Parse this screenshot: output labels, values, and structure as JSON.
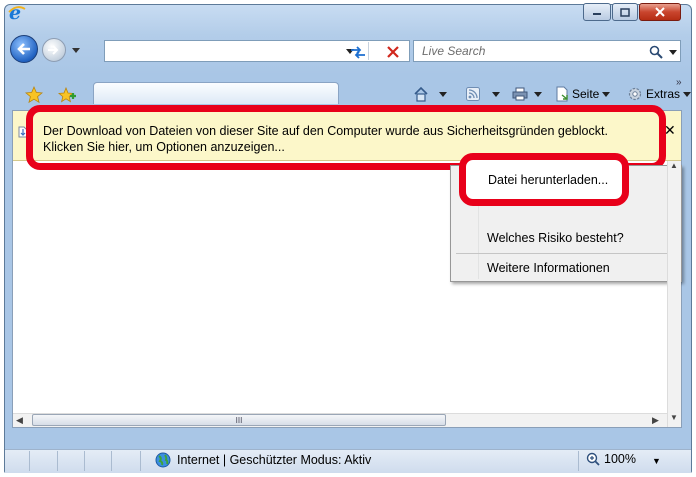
{
  "window": {
    "app_icon": "ie-logo-icon",
    "caption_buttons": [
      "minimize-icon",
      "maximize-icon",
      "close-icon"
    ]
  },
  "nav": {
    "address_value": "",
    "search_placeholder": "Live Search"
  },
  "commandbar": {
    "page_label": "Seite",
    "tools_label": "Extras"
  },
  "infobar": {
    "line1": "Der Download von Dateien von dieser Site auf den Computer wurde aus Sicherheitsgründen geblockt.",
    "line2": "Klicken Sie hier, um Optionen anzuzeigen...",
    "close_glyph": "✕"
  },
  "context_menu": {
    "items": [
      {
        "label": "Datei herunterladen..."
      },
      {
        "label": "Welches Risiko besteht?"
      },
      {
        "label": "Weitere Informationen"
      }
    ]
  },
  "scrollbar": {
    "thumb_grip": "III"
  },
  "status": {
    "zone_text": "Internet | Geschützter Modus: Aktiv",
    "zoom": "100%"
  },
  "colors": {
    "highlight": "#e8001a",
    "infobar_bg": "#fcf7c9",
    "chrome": "#a9c6e6"
  }
}
